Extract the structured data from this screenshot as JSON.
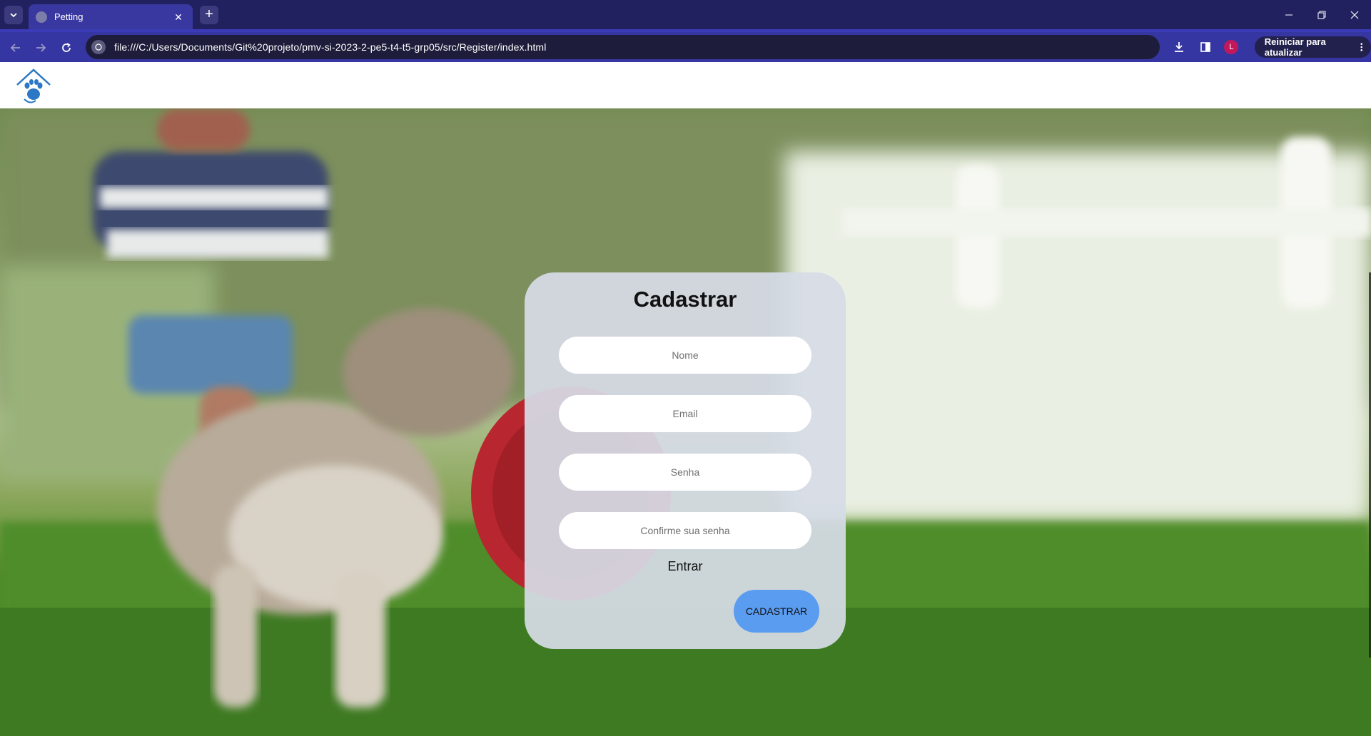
{
  "browser": {
    "tab_title": "Petting",
    "new_tab_symbol": "+",
    "url": "file:///C:/Users/Documents/Git%20projeto/pmv-si-2023-2-pe5-t4-t5-grp05/src/Register/index.html",
    "profile_initial": "L",
    "update_button_label": "Reiniciar para atualizar",
    "icons": [
      "tab-search-icon",
      "close-icon",
      "plus-icon",
      "minimize-icon",
      "restore-icon",
      "window-close-icon",
      "back-arrow-icon",
      "forward-arrow-icon",
      "reload-icon",
      "site-info-icon",
      "download-icon",
      "side-panel-icon",
      "kebab-menu-icon"
    ]
  },
  "page": {
    "logo_icon": "house-paw-logo-icon",
    "form": {
      "title": "Cadastrar",
      "name_placeholder": "Nome",
      "email_placeholder": "Email",
      "password_placeholder": "Senha",
      "confirm_placeholder": "Confirme sua senha",
      "login_link": "Entrar",
      "submit_label": "CADASTRAR"
    }
  },
  "colors": {
    "chrome_dark": "#22215f",
    "chrome_toolbar": "#3636a2",
    "submit_button": "#5a9cf0",
    "card_bg": "#d6dce6",
    "logo_blue": "#2b78c6"
  }
}
